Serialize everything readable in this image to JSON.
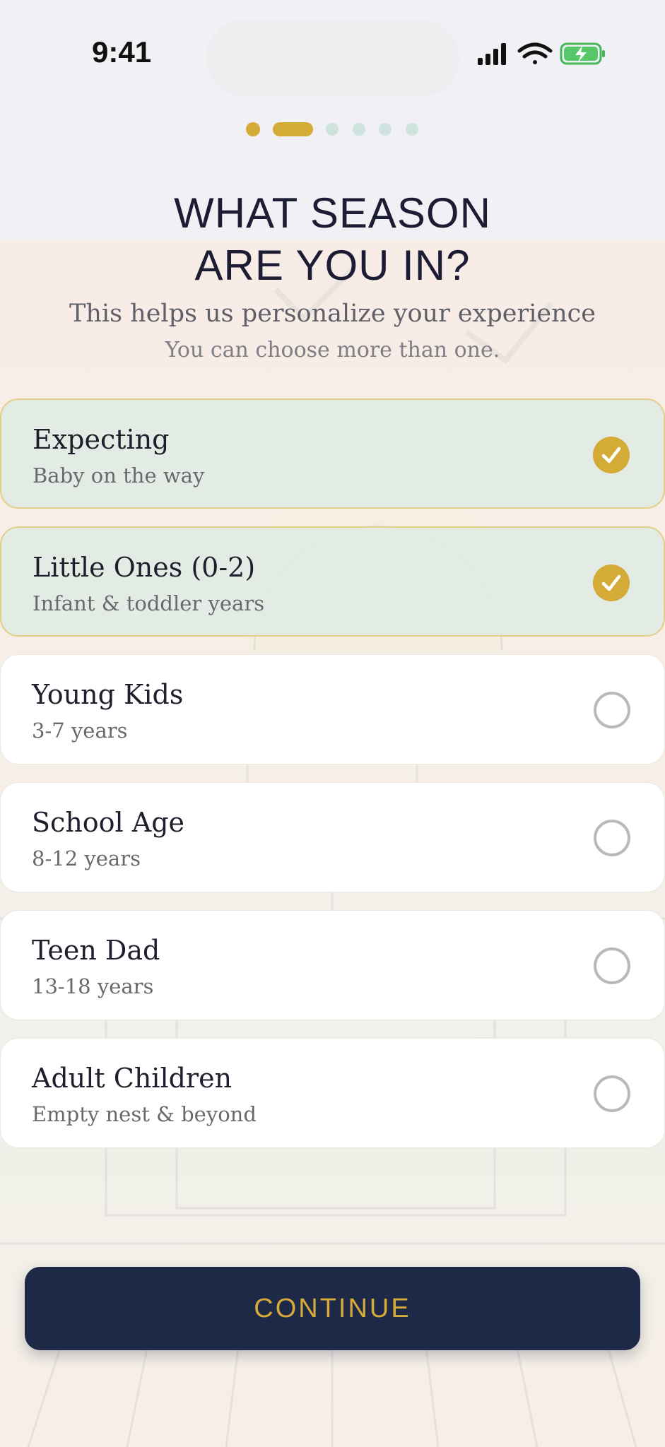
{
  "status_bar": {
    "time": "9:41"
  },
  "progress": {
    "total_steps": 6,
    "current_step": 2
  },
  "header": {
    "title_line1": "WHAT SEASON",
    "title_line2": "ARE YOU IN?",
    "subtitle": "This helps us personalize your experience",
    "hint": "You can choose more than one."
  },
  "options": [
    {
      "title": "Expecting",
      "subtitle": "Baby on the way",
      "selected": true
    },
    {
      "title": "Little Ones (0-2)",
      "subtitle": "Infant & toddler years",
      "selected": true
    },
    {
      "title": "Young Kids",
      "subtitle": "3-7 years",
      "selected": false
    },
    {
      "title": "School Age",
      "subtitle": "8-12 years",
      "selected": false
    },
    {
      "title": "Teen Dad",
      "subtitle": "13-18 years",
      "selected": false
    },
    {
      "title": "Adult Children",
      "subtitle": "Empty nest & beyond",
      "selected": false
    }
  ],
  "continue_label": "CONTINUE",
  "colors": {
    "accent_gold": "#d5ab38",
    "navy": "#1e2847",
    "selected_bg": "#e1ece4",
    "dot_inactive": "#cfe3de"
  },
  "icons": {
    "signal": "cellular-signal-icon",
    "wifi": "wifi-icon",
    "battery": "battery-charging-icon",
    "check": "checkmark-icon"
  }
}
